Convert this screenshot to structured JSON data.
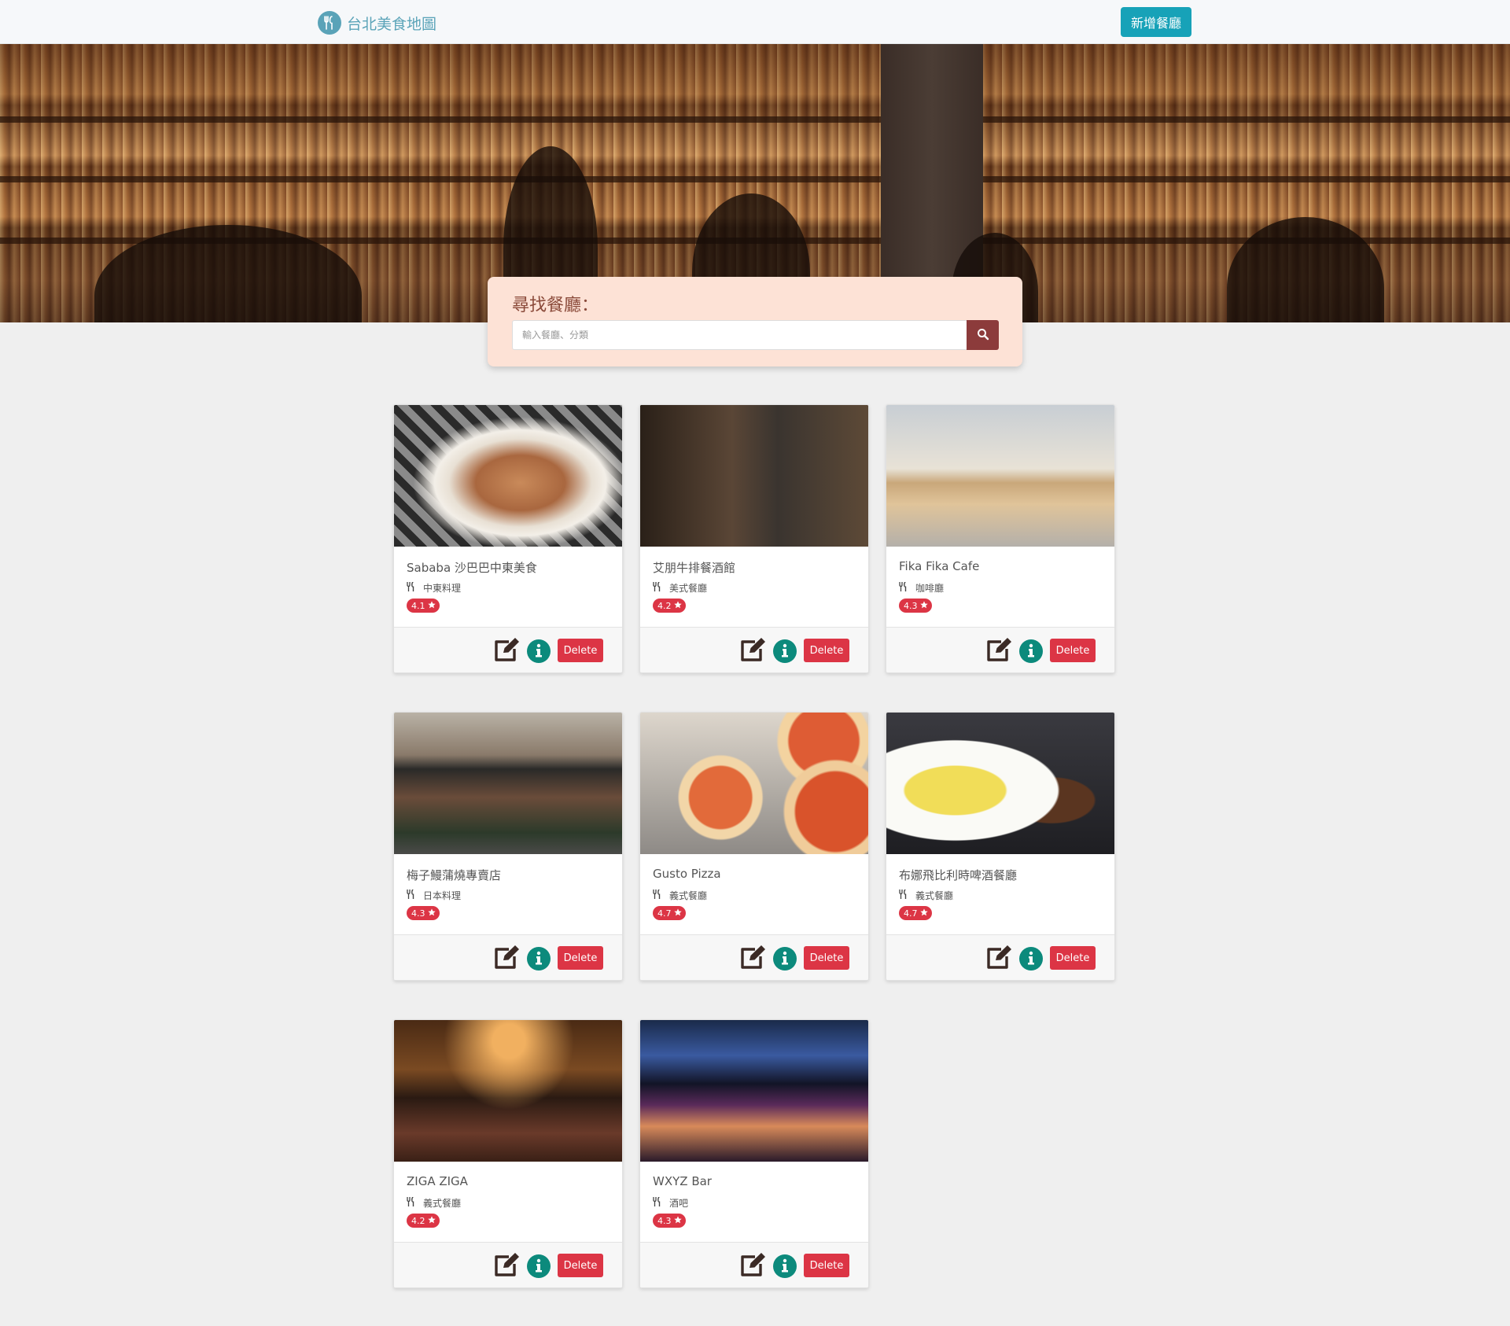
{
  "navbar": {
    "brand_name": "台北美食地圖",
    "brand_icon": "utensils-icon",
    "add_button_label": "新增餐廳"
  },
  "search": {
    "title": "尋找餐廳：",
    "placeholder": "輸入餐廳、分類",
    "button_icon": "search-icon"
  },
  "colors": {
    "brand": "#5aa3b8",
    "add_button": "#17a2b8",
    "search_panel": "#fde2d6",
    "search_button": "#8c3b3b",
    "rating_badge": "#dc3545",
    "info_button": "#0c8a7c",
    "delete_button": "#dc3545"
  },
  "restaurants": [
    {
      "name": "Sababa 沙巴巴中東美食",
      "category": "中東料理",
      "rating": "4.1",
      "delete_label": "Delete"
    },
    {
      "name": "艾朋牛排餐酒館",
      "category": "美式餐廳",
      "rating": "4.2",
      "delete_label": "Delete"
    },
    {
      "name": "Fika Fika Cafe",
      "category": "咖啡廳",
      "rating": "4.3",
      "delete_label": "Delete"
    },
    {
      "name": "梅子鰻蒲燒專賣店",
      "category": "日本料理",
      "rating": "4.3",
      "delete_label": "Delete"
    },
    {
      "name": "Gusto Pizza",
      "category": "義式餐廳",
      "rating": "4.7",
      "delete_label": "Delete"
    },
    {
      "name": "布娜飛比利時啤酒餐廳",
      "category": "義式餐廳",
      "rating": "4.7",
      "delete_label": "Delete"
    },
    {
      "name": "ZIGA ZIGA",
      "category": "義式餐廳",
      "rating": "4.2",
      "delete_label": "Delete"
    },
    {
      "name": "WXYZ Bar",
      "category": "酒吧",
      "rating": "4.3",
      "delete_label": "Delete"
    }
  ]
}
